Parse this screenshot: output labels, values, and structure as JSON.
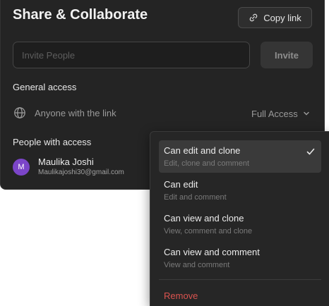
{
  "header": {
    "title": "Share & Collaborate",
    "copy_link_label": "Copy link",
    "copy_link_icon": "link-icon"
  },
  "invite": {
    "placeholder": "Invite People",
    "value": "",
    "button_label": "Invite"
  },
  "general_access": {
    "label": "General access",
    "icon": "globe-icon",
    "link_text": "Anyone with the link",
    "selected_value": "Full Access"
  },
  "people": {
    "label": "People with access",
    "users": [
      {
        "initial": "M",
        "name": "Maulika Joshi",
        "email": "Maulikajoshi30@gmail.com",
        "avatar_color": "#7b45c8"
      }
    ]
  },
  "dropdown": {
    "items": [
      {
        "label": "Can edit and clone",
        "description": "Edit, clone and comment",
        "selected": true
      },
      {
        "label": "Can edit",
        "description": "Edit and comment",
        "selected": false
      },
      {
        "label": "Can view and clone",
        "description": "View, comment and clone",
        "selected": false
      },
      {
        "label": "Can view and comment",
        "description": "View and comment",
        "selected": false
      }
    ],
    "remove_label": "Remove",
    "remove_color": "#d9534f"
  },
  "colors": {
    "panel_bg": "#242424",
    "accent_avatar": "#7b45c8"
  }
}
